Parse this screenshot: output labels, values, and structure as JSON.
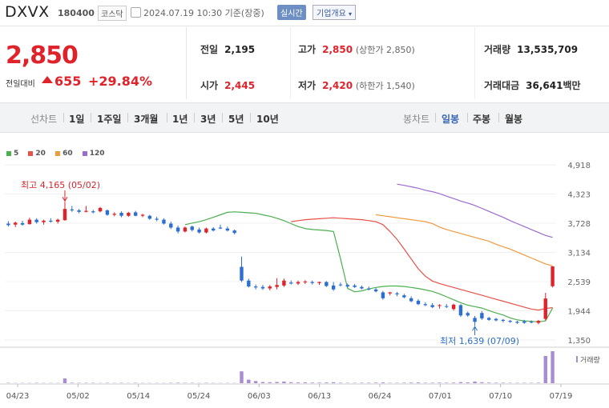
{
  "header": {
    "name": "DXVX",
    "code": "180400",
    "market": "코스닥",
    "datetime": "2024.07.19 10:30 기준(장중)",
    "realtime_label": "실시간",
    "corp_label": "기업개요"
  },
  "quote": {
    "price": "2,850",
    "change_label": "전일대비",
    "change": "655",
    "change_pct": "+29.84%",
    "prev_close_label": "전일",
    "prev_close": "2,195",
    "high_label": "고가",
    "high": "2,850",
    "upper_limit": "(상한가 2,850)",
    "volume_label": "거래량",
    "volume": "13,535,709",
    "open_label": "시가",
    "open": "2,445",
    "low_label": "저가",
    "low": "2,420",
    "lower_limit": "(하한가 1,540)",
    "amount_label": "거래대금",
    "amount": "36,641",
    "amount_unit": "백만"
  },
  "toolbar": {
    "line_chart_label": "선차트",
    "periods": [
      "1일",
      "1주일",
      "3개월",
      "1년",
      "3년",
      "5년",
      "10년"
    ],
    "candle_chart_label": "봉차트",
    "candle_periods": [
      "일봉",
      "주봉",
      "월봉"
    ],
    "selected": "일봉"
  },
  "legend": [
    {
      "name": "5",
      "color": "#4caf50"
    },
    {
      "name": "20",
      "color": "#e8504a"
    },
    {
      "name": "60",
      "color": "#f09a3e"
    },
    {
      "name": "120",
      "color": "#9b6ad0"
    }
  ],
  "chart_data": {
    "type": "candlestick",
    "y_ticks": [
      "4,918",
      "4,323",
      "3,728",
      "3,134",
      "2,539",
      "1,944",
      "1,350"
    ],
    "ylim": [
      1350,
      4918
    ],
    "x_ticks": [
      "04/23",
      "05/02",
      "05/14",
      "05/24",
      "06/03",
      "06/13",
      "06/24",
      "07/01",
      "07/10",
      "07/19"
    ],
    "annotations": {
      "high": "최고 4,165 (05/02)",
      "low": "최저 1,639 (07/09)"
    },
    "volume_label": "거래량",
    "candles": [
      {
        "o": 3720,
        "h": 3770,
        "l": 3660,
        "c": 3690
      },
      {
        "o": 3700,
        "h": 3760,
        "l": 3650,
        "c": 3740
      },
      {
        "o": 3730,
        "h": 3780,
        "l": 3680,
        "c": 3700
      },
      {
        "o": 3710,
        "h": 3840,
        "l": 3700,
        "c": 3800
      },
      {
        "o": 3800,
        "h": 3830,
        "l": 3720,
        "c": 3750
      },
      {
        "o": 3750,
        "h": 3800,
        "l": 3700,
        "c": 3780
      },
      {
        "o": 3780,
        "h": 3830,
        "l": 3740,
        "c": 3760
      },
      {
        "o": 3760,
        "h": 3820,
        "l": 3720,
        "c": 3800
      },
      {
        "o": 3790,
        "h": 4165,
        "l": 3780,
        "c": 4020
      },
      {
        "o": 4010,
        "h": 4080,
        "l": 3960,
        "c": 3990
      },
      {
        "o": 3990,
        "h": 4020,
        "l": 3930,
        "c": 3960
      },
      {
        "o": 3960,
        "h": 4080,
        "l": 3950,
        "c": 3980
      },
      {
        "o": 3970,
        "h": 4000,
        "l": 3930,
        "c": 3950
      },
      {
        "o": 3970,
        "h": 4060,
        "l": 3950,
        "c": 4040
      },
      {
        "o": 3990,
        "h": 4010,
        "l": 3880,
        "c": 3900
      },
      {
        "o": 3900,
        "h": 3950,
        "l": 3870,
        "c": 3920
      },
      {
        "o": 3940,
        "h": 3970,
        "l": 3850,
        "c": 3880
      },
      {
        "o": 3880,
        "h": 3960,
        "l": 3860,
        "c": 3940
      },
      {
        "o": 3950,
        "h": 3980,
        "l": 3870,
        "c": 3880
      },
      {
        "o": 3880,
        "h": 3920,
        "l": 3850,
        "c": 3900
      },
      {
        "o": 3880,
        "h": 3900,
        "l": 3800,
        "c": 3820
      },
      {
        "o": 3820,
        "h": 3860,
        "l": 3770,
        "c": 3800
      },
      {
        "o": 3800,
        "h": 3830,
        "l": 3700,
        "c": 3720
      },
      {
        "o": 3720,
        "h": 3760,
        "l": 3610,
        "c": 3640
      },
      {
        "o": 3640,
        "h": 3680,
        "l": 3520,
        "c": 3560
      },
      {
        "o": 3560,
        "h": 3660,
        "l": 3540,
        "c": 3640
      },
      {
        "o": 3660,
        "h": 3680,
        "l": 3560,
        "c": 3590
      },
      {
        "o": 3600,
        "h": 3640,
        "l": 3520,
        "c": 3540
      },
      {
        "o": 3540,
        "h": 3640,
        "l": 3520,
        "c": 3620
      },
      {
        "o": 3620,
        "h": 3650,
        "l": 3560,
        "c": 3580
      },
      {
        "o": 3640,
        "h": 3700,
        "l": 3610,
        "c": 3620
      },
      {
        "o": 3620,
        "h": 3660,
        "l": 3560,
        "c": 3580
      },
      {
        "o": 3580,
        "h": 3600,
        "l": 3500,
        "c": 3530
      },
      {
        "o": 2840,
        "h": 3050,
        "l": 2530,
        "c": 2560
      },
      {
        "o": 2560,
        "h": 2600,
        "l": 2420,
        "c": 2440
      },
      {
        "o": 2440,
        "h": 2480,
        "l": 2380,
        "c": 2420
      },
      {
        "o": 2430,
        "h": 2470,
        "l": 2370,
        "c": 2400
      },
      {
        "o": 2400,
        "h": 2470,
        "l": 2360,
        "c": 2440
      },
      {
        "o": 2430,
        "h": 2610,
        "l": 2380,
        "c": 2470
      },
      {
        "o": 2460,
        "h": 2600,
        "l": 2430,
        "c": 2560
      },
      {
        "o": 2520,
        "h": 2560,
        "l": 2480,
        "c": 2500
      },
      {
        "o": 2500,
        "h": 2560,
        "l": 2470,
        "c": 2530
      },
      {
        "o": 2530,
        "h": 2570,
        "l": 2490,
        "c": 2540
      },
      {
        "o": 2530,
        "h": 2560,
        "l": 2480,
        "c": 2510
      },
      {
        "o": 2510,
        "h": 2540,
        "l": 2470,
        "c": 2530
      },
      {
        "o": 2530,
        "h": 2550,
        "l": 2430,
        "c": 2450
      },
      {
        "o": 2460,
        "h": 2530,
        "l": 2350,
        "c": 2380
      },
      {
        "o": 2480,
        "h": 2520,
        "l": 2440,
        "c": 2470
      },
      {
        "o": 2470,
        "h": 2500,
        "l": 2420,
        "c": 2440
      },
      {
        "o": 2460,
        "h": 2490,
        "l": 2410,
        "c": 2430
      },
      {
        "o": 2430,
        "h": 2460,
        "l": 2380,
        "c": 2400
      },
      {
        "o": 2400,
        "h": 2440,
        "l": 2360,
        "c": 2380
      },
      {
        "o": 2380,
        "h": 2410,
        "l": 2320,
        "c": 2340
      },
      {
        "o": 2320,
        "h": 2350,
        "l": 2170,
        "c": 2200
      },
      {
        "o": 2300,
        "h": 2330,
        "l": 2260,
        "c": 2320
      },
      {
        "o": 2300,
        "h": 2330,
        "l": 2240,
        "c": 2280
      },
      {
        "o": 2260,
        "h": 2290,
        "l": 2200,
        "c": 2220
      },
      {
        "o": 2200,
        "h": 2240,
        "l": 2120,
        "c": 2140
      },
      {
        "o": 2150,
        "h": 2180,
        "l": 2060,
        "c": 2080
      },
      {
        "o": 2080,
        "h": 2120,
        "l": 2040,
        "c": 2060
      },
      {
        "o": 2060,
        "h": 2100,
        "l": 2000,
        "c": 2020
      },
      {
        "o": 2050,
        "h": 2080,
        "l": 1990,
        "c": 2060
      },
      {
        "o": 2040,
        "h": 2080,
        "l": 2000,
        "c": 2030
      },
      {
        "o": 1980,
        "h": 2090,
        "l": 1950,
        "c": 2070
      },
      {
        "o": 2060,
        "h": 2080,
        "l": 1820,
        "c": 1850
      },
      {
        "o": 1900,
        "h": 1930,
        "l": 1820,
        "c": 1850
      },
      {
        "o": 1800,
        "h": 1840,
        "l": 1639,
        "c": 1720
      },
      {
        "o": 1900,
        "h": 1940,
        "l": 1760,
        "c": 1790
      },
      {
        "o": 1800,
        "h": 1820,
        "l": 1740,
        "c": 1760
      },
      {
        "o": 1780,
        "h": 1800,
        "l": 1730,
        "c": 1750
      },
      {
        "o": 1760,
        "h": 1780,
        "l": 1710,
        "c": 1740
      },
      {
        "o": 1740,
        "h": 1760,
        "l": 1700,
        "c": 1720
      },
      {
        "o": 1720,
        "h": 1740,
        "l": 1680,
        "c": 1700
      },
      {
        "o": 1730,
        "h": 1760,
        "l": 1680,
        "c": 1700
      },
      {
        "o": 1720,
        "h": 1750,
        "l": 1690,
        "c": 1710
      },
      {
        "o": 1700,
        "h": 1760,
        "l": 1670,
        "c": 1740
      },
      {
        "o": 1780,
        "h": 2310,
        "l": 1750,
        "c": 2195
      },
      {
        "o": 2445,
        "h": 2850,
        "l": 2420,
        "c": 2850
      }
    ],
    "ma5": [
      3700,
      3730,
      3760,
      3800,
      3850,
      3900,
      3950,
      3960,
      3950,
      3940,
      3930,
      3900,
      3870,
      3830,
      3780,
      3720,
      3660,
      3620,
      3600,
      3590,
      3580,
      3560,
      3000,
      2400,
      2330,
      2350,
      2390,
      2420,
      2440,
      2450,
      2450,
      2440,
      2420,
      2400,
      2370,
      2340,
      2290,
      2230,
      2170,
      2110,
      2060,
      2030,
      2000,
      1950,
      1900,
      1860,
      1800,
      1760,
      1740,
      1730,
      1720,
      1740,
      2000
    ],
    "ma20": [
      3760,
      3780,
      3800,
      3810,
      3820,
      3830,
      3840,
      3830,
      3820,
      3810,
      3800,
      3780,
      3760,
      3700,
      3560,
      3400,
      3200,
      3000,
      2800,
      2650,
      2550,
      2500,
      2460,
      2420,
      2380,
      2340,
      2300,
      2260,
      2220,
      2180,
      2140,
      2100,
      2060,
      2020,
      1980,
      1960,
      1990,
      2010
    ],
    "ma60": [
      3900,
      3880,
      3860,
      3840,
      3820,
      3800,
      3780,
      3760,
      3720,
      3650,
      3600,
      3560,
      3520,
      3480,
      3440,
      3400,
      3360,
      3300,
      3250,
      3200,
      3140,
      3080,
      3020,
      2960,
      2900,
      2860
    ],
    "ma120": [
      4523,
      4500,
      4470,
      4440,
      4400,
      4370,
      4330,
      4280,
      4230,
      4180,
      4140,
      4090,
      4030,
      3970,
      3910,
      3850,
      3780,
      3720,
      3660,
      3600,
      3540,
      3480,
      3440
    ],
    "volume": [
      3,
      2,
      2,
      2,
      3,
      2,
      2,
      2,
      40,
      4,
      3,
      3,
      3,
      2,
      3,
      2,
      3,
      2,
      3,
      2,
      2,
      2,
      2,
      3,
      4,
      3,
      3,
      2,
      3,
      2,
      2,
      2,
      2,
      100,
      30,
      18,
      10,
      8,
      10,
      14,
      8,
      6,
      7,
      5,
      5,
      6,
      8,
      4,
      3,
      3,
      4,
      4,
      5,
      6,
      3,
      3,
      4,
      5,
      6,
      4,
      4,
      5,
      4,
      5,
      9,
      7,
      14,
      8,
      5,
      4,
      4,
      3,
      3,
      3,
      3,
      4,
      230,
      270
    ]
  }
}
